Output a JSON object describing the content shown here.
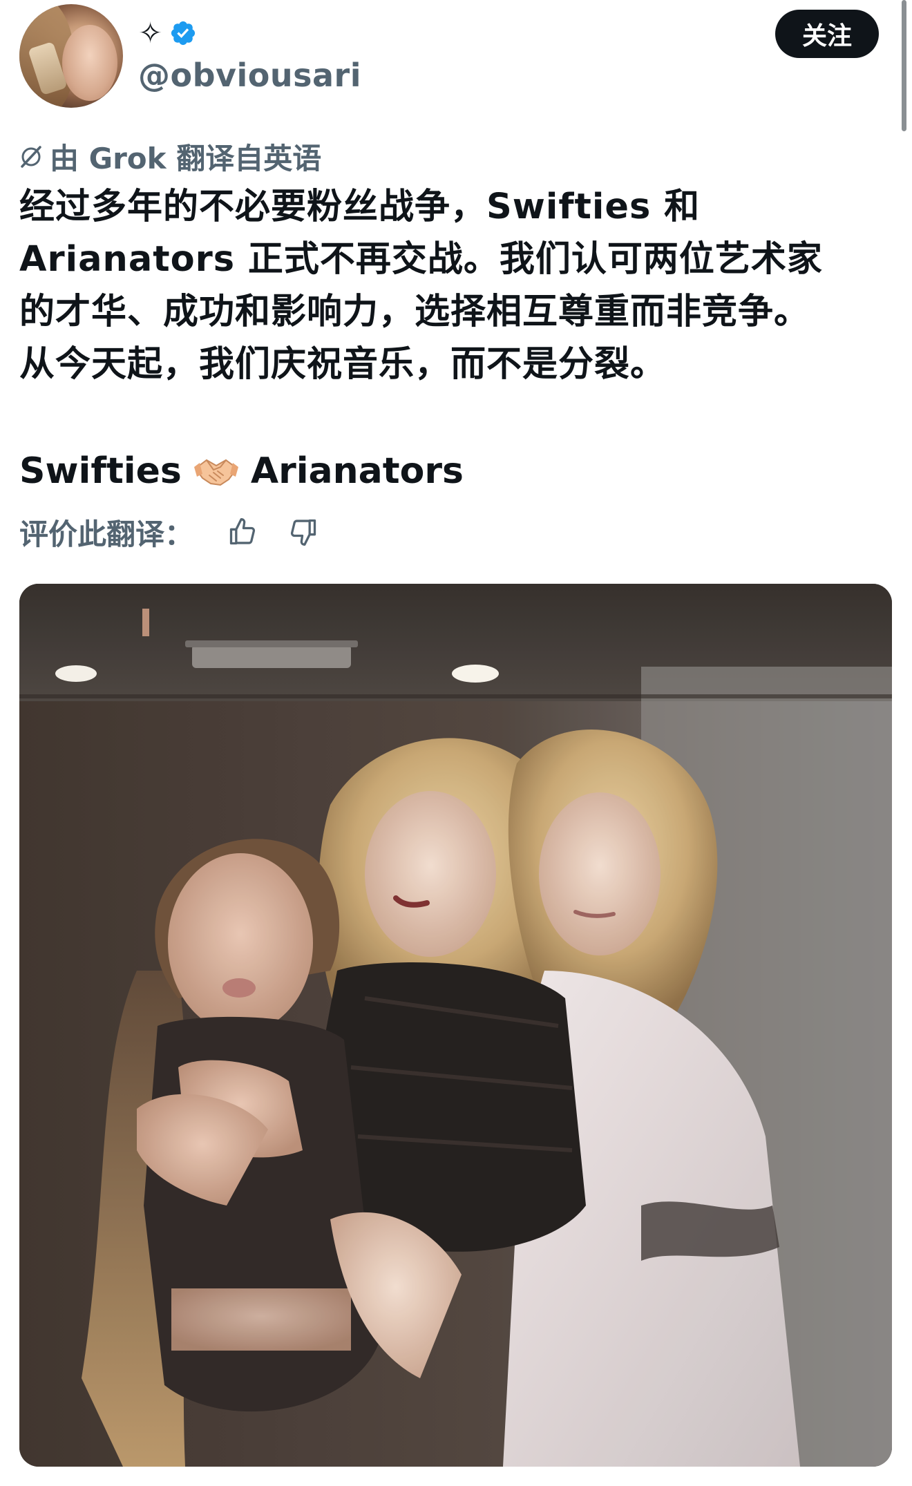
{
  "header": {
    "display_name_icon": "sparkle-icon",
    "sparkle_glyph": "✧",
    "verified_icon": "verified-badge-icon",
    "verified_color": "#1d9bf0",
    "handle": "@obviousari",
    "follow_label": "关注"
  },
  "translation": {
    "note_icon": "grok-icon",
    "note_text": "由 Grok 翻译自英语",
    "rate_label": "评价此翻译：",
    "thumbs_up_icon": "thumbs-up-icon",
    "thumbs_down_icon": "thumbs-down-icon"
  },
  "tweet": {
    "lines": [
      "经过多年的不必要粉丝战争，Swifties 和",
      "Arianators 正式不再交战。我们认可两位艺术家",
      "的才华、成功和影响力，选择相互尊重而非竞争。",
      "从今天起，我们庆祝音乐，而不是分裂。"
    ],
    "tagline_left": "Swifties",
    "tagline_icon": "handshake-icon",
    "tagline_right": "Arianators"
  },
  "media": {
    "type": "photo",
    "description_icon": "photo-image"
  },
  "colors": {
    "text_primary": "#0f1419",
    "text_secondary": "#536471",
    "button_bg": "#0f1419",
    "button_text": "#ffffff"
  }
}
